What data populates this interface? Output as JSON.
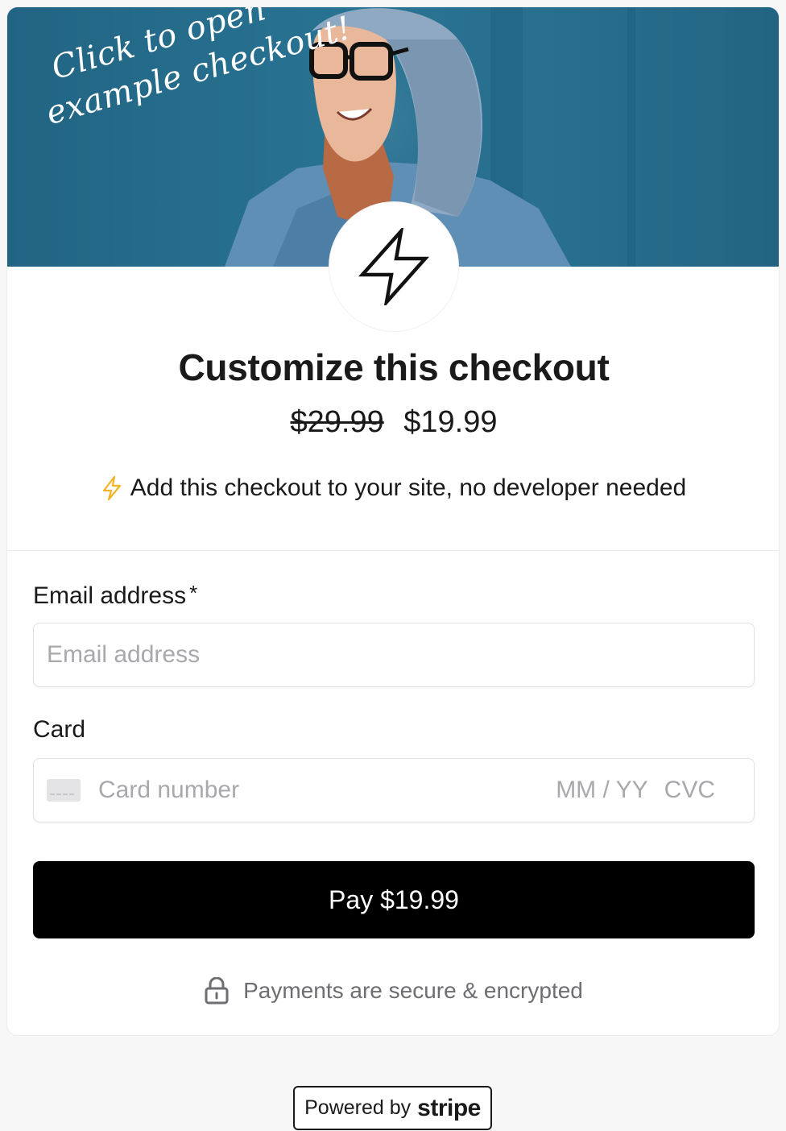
{
  "hero": {
    "tagline_line1": "Click to open",
    "tagline_line2": "example checkout!",
    "background_color": "#2a7595"
  },
  "logo": {
    "icon": "lightning-bolt-icon"
  },
  "product": {
    "title": "Customize this checkout",
    "original_price": "$29.99",
    "price": "$19.99",
    "description": "Add this checkout to your site, no developer needed",
    "description_icon": "lightning-bolt-icon",
    "description_icon_color": "#f5b326"
  },
  "form": {
    "email": {
      "label": "Email address",
      "required_mark": "*",
      "placeholder": "Email address",
      "value": ""
    },
    "card": {
      "label": "Card",
      "number_placeholder": "Card number",
      "expiry_placeholder": "MM / YY",
      "cvc_placeholder": "CVC",
      "icon": "credit-card-icon"
    },
    "pay_button": {
      "label": "Pay $19.99",
      "color": "#000000"
    }
  },
  "footer": {
    "secure_text": "Payments are secure & encrypted",
    "secure_icon": "lock-icon",
    "powered_by_text": "Powered by",
    "powered_by_brand": "stripe"
  }
}
